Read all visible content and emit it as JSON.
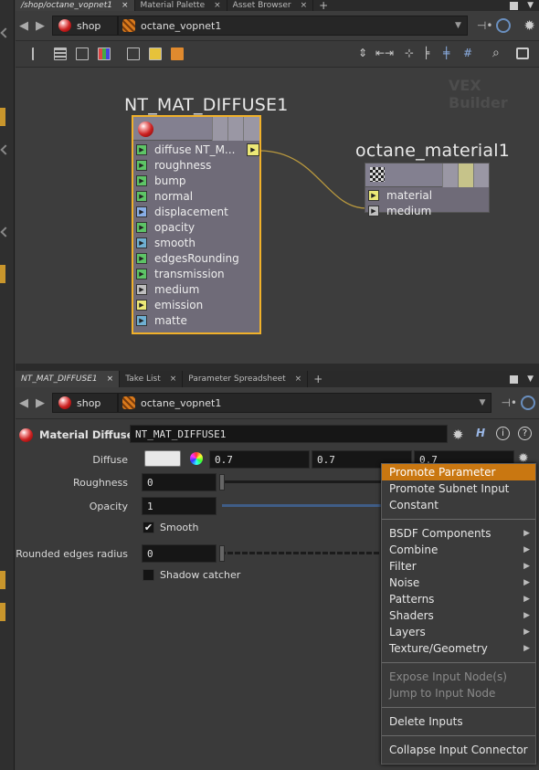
{
  "top_tabs": [
    {
      "label": "/shop/octane_vopnet1",
      "active": true
    },
    {
      "label": "Material Palette",
      "active": false
    },
    {
      "label": "Asset Browser",
      "active": false
    }
  ],
  "tab_close": "×",
  "tab_add": "+",
  "path": {
    "root": "shop",
    "node": "octane_vopnet1"
  },
  "network_type_label": "VEX Builder",
  "node_a": {
    "title": "NT_MAT_DIFFUSE1",
    "output_label": "diffuse   NT_M...",
    "inputs": [
      "roughness",
      "bump",
      "normal",
      "displacement",
      "opacity",
      "smooth",
      "edgesRounding",
      "transmission",
      "medium",
      "emission",
      "matte"
    ]
  },
  "node_b": {
    "title": "octane_material1",
    "inputs": [
      "material",
      "medium"
    ]
  },
  "bottom_tabs": [
    {
      "label": "NT_MAT_DIFFUSE1",
      "active": true
    },
    {
      "label": "Take List",
      "active": false
    },
    {
      "label": "Parameter Spreadsheet",
      "active": false
    }
  ],
  "params": {
    "node_type": "Material Diffuse",
    "node_name": "NT_MAT_DIFFUSE1",
    "help_h": "H",
    "help_i": "i",
    "help_q": "?",
    "diffuse_label": "Diffuse",
    "diffuse_values": [
      "0.7",
      "0.7",
      "0.7"
    ],
    "roughness_label": "Roughness",
    "roughness_value": "0",
    "opacity_label": "Opacity",
    "opacity_value": "1",
    "smooth_label": "Smooth",
    "rounded_label": "Rounded edges radius",
    "rounded_value": "0",
    "shadow_label": "Shadow catcher"
  },
  "context_menu": {
    "group1": [
      "Promote Parameter",
      "Promote Subnet Input",
      "Constant"
    ],
    "group2": [
      "BSDF Components",
      "Combine",
      "Filter",
      "Noise",
      "Patterns",
      "Shaders",
      "Layers",
      "Texture/Geometry"
    ],
    "group3": [
      "Expose Input Node(s)",
      "Jump to Input Node"
    ],
    "group4": [
      "Delete Inputs"
    ],
    "group5": [
      "Collapse Input Connector"
    ],
    "submenu_arrow": "▶"
  },
  "colors": {
    "accent": "#c97711",
    "node_border": "#f0b12a",
    "wire": "#b8983e"
  }
}
